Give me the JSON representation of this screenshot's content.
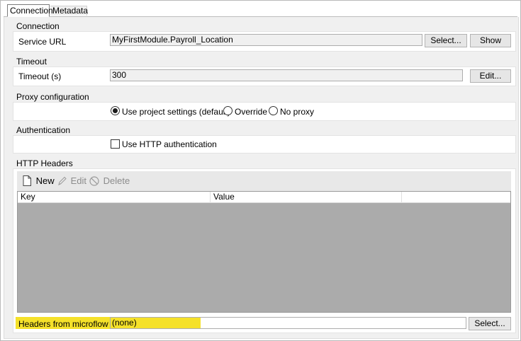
{
  "tabs": [
    {
      "label": "Connection",
      "active": true
    },
    {
      "label": "Metadata",
      "active": false
    }
  ],
  "connection": {
    "group_title": "Connection",
    "service_url_label": "Service URL",
    "service_url_value": "MyFirstModule.Payroll_Location",
    "select_button": "Select...",
    "show_button": "Show"
  },
  "timeout": {
    "group_title": "Timeout",
    "label": "Timeout (s)",
    "value": "300",
    "edit_button": "Edit..."
  },
  "proxy": {
    "group_title": "Proxy configuration",
    "options": [
      {
        "label": "Use project settings (default)",
        "selected": true
      },
      {
        "label": "Override",
        "selected": false
      },
      {
        "label": "No proxy",
        "selected": false
      }
    ]
  },
  "authentication": {
    "group_title": "Authentication",
    "checkbox_label": "Use HTTP authentication",
    "checked": false
  },
  "http_headers": {
    "group_title": "HTTP Headers",
    "toolbar": {
      "new_label": "New",
      "edit_label": "Edit",
      "delete_label": "Delete"
    },
    "columns": [
      "Key",
      "Value"
    ],
    "headers_from_microflow_label": "Headers from microflow",
    "headers_from_microflow_value": "(none)",
    "select_button": "Select..."
  },
  "colors": {
    "highlight": "#f5e12a",
    "grid_empty": "#ababab",
    "background": "#f0f0f0"
  }
}
